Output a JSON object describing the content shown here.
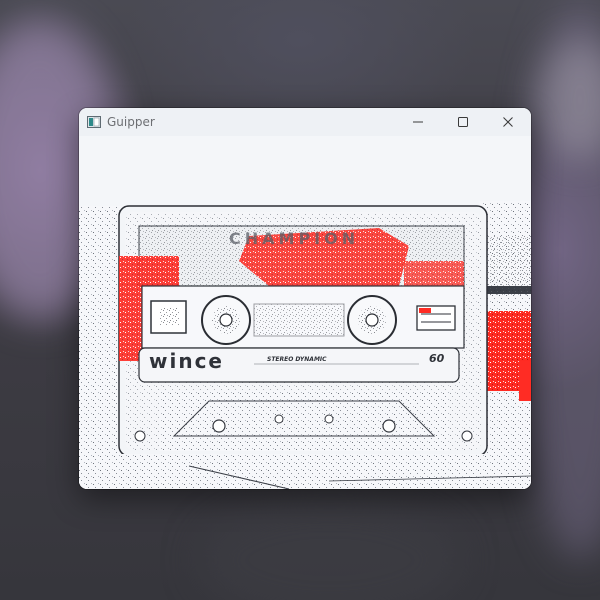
{
  "window": {
    "title": "Guipper",
    "icons": {
      "app": "app-icon",
      "minimize": "minimize-icon",
      "maximize": "maximize-icon",
      "close": "close-icon"
    }
  },
  "content": {
    "cassette_label": {
      "brand": "wince",
      "brand_top": "CHAMPION",
      "subtitle": "STEREO DYNAMIC",
      "length": "60"
    }
  },
  "colors": {
    "accent_red": "#e8201e",
    "window_bg": "#f1f4f8",
    "titlebar_bg": "#eef1f5"
  }
}
